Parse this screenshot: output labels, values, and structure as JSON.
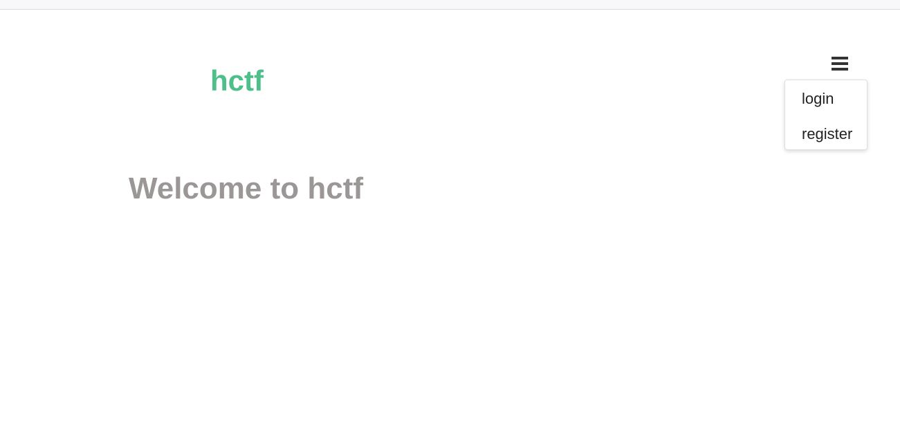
{
  "header": {
    "brand": "hctf",
    "menu_icon": "hamburger-menu-icon"
  },
  "menu": {
    "items": [
      {
        "label": "login"
      },
      {
        "label": "register"
      }
    ]
  },
  "main": {
    "heading": "Welcome to hctf"
  },
  "colors": {
    "brand": "#4cbf8a",
    "heading": "#9a9796",
    "menu_text": "#222222",
    "icon": "#333333"
  }
}
